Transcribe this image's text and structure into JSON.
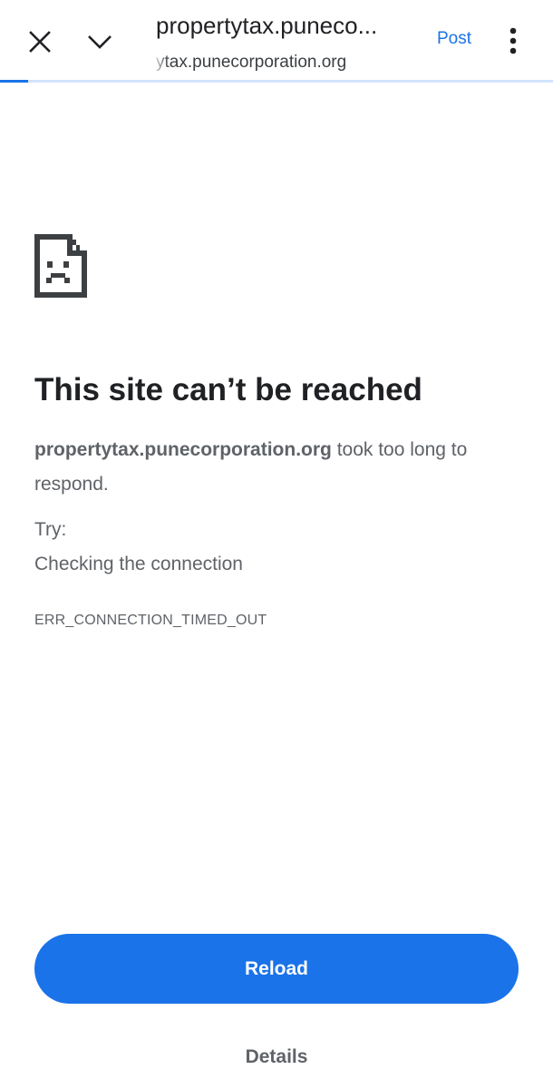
{
  "toolbar": {
    "title": "propertytax.puneco...",
    "url": "ytax.punecorporation.org",
    "post_label": "Post",
    "close_icon": "close-icon",
    "chevron_icon": "chevron-down-icon",
    "menu_icon": "more-vert-icon",
    "load_progress": 0.05,
    "accent_color": "#1a73e8"
  },
  "error": {
    "icon": "sad-page-icon",
    "heading": "This site can’t be reached",
    "host": "propertytax.punecorporation.org",
    "message": " took too long to respond.",
    "try_label": "Try:",
    "suggestion": "Checking the connection",
    "code": "ERR_CONNECTION_TIMED_OUT"
  },
  "actions": {
    "reload_label": "Reload",
    "details_label": "Details",
    "reload_color": "#1a73e8"
  }
}
